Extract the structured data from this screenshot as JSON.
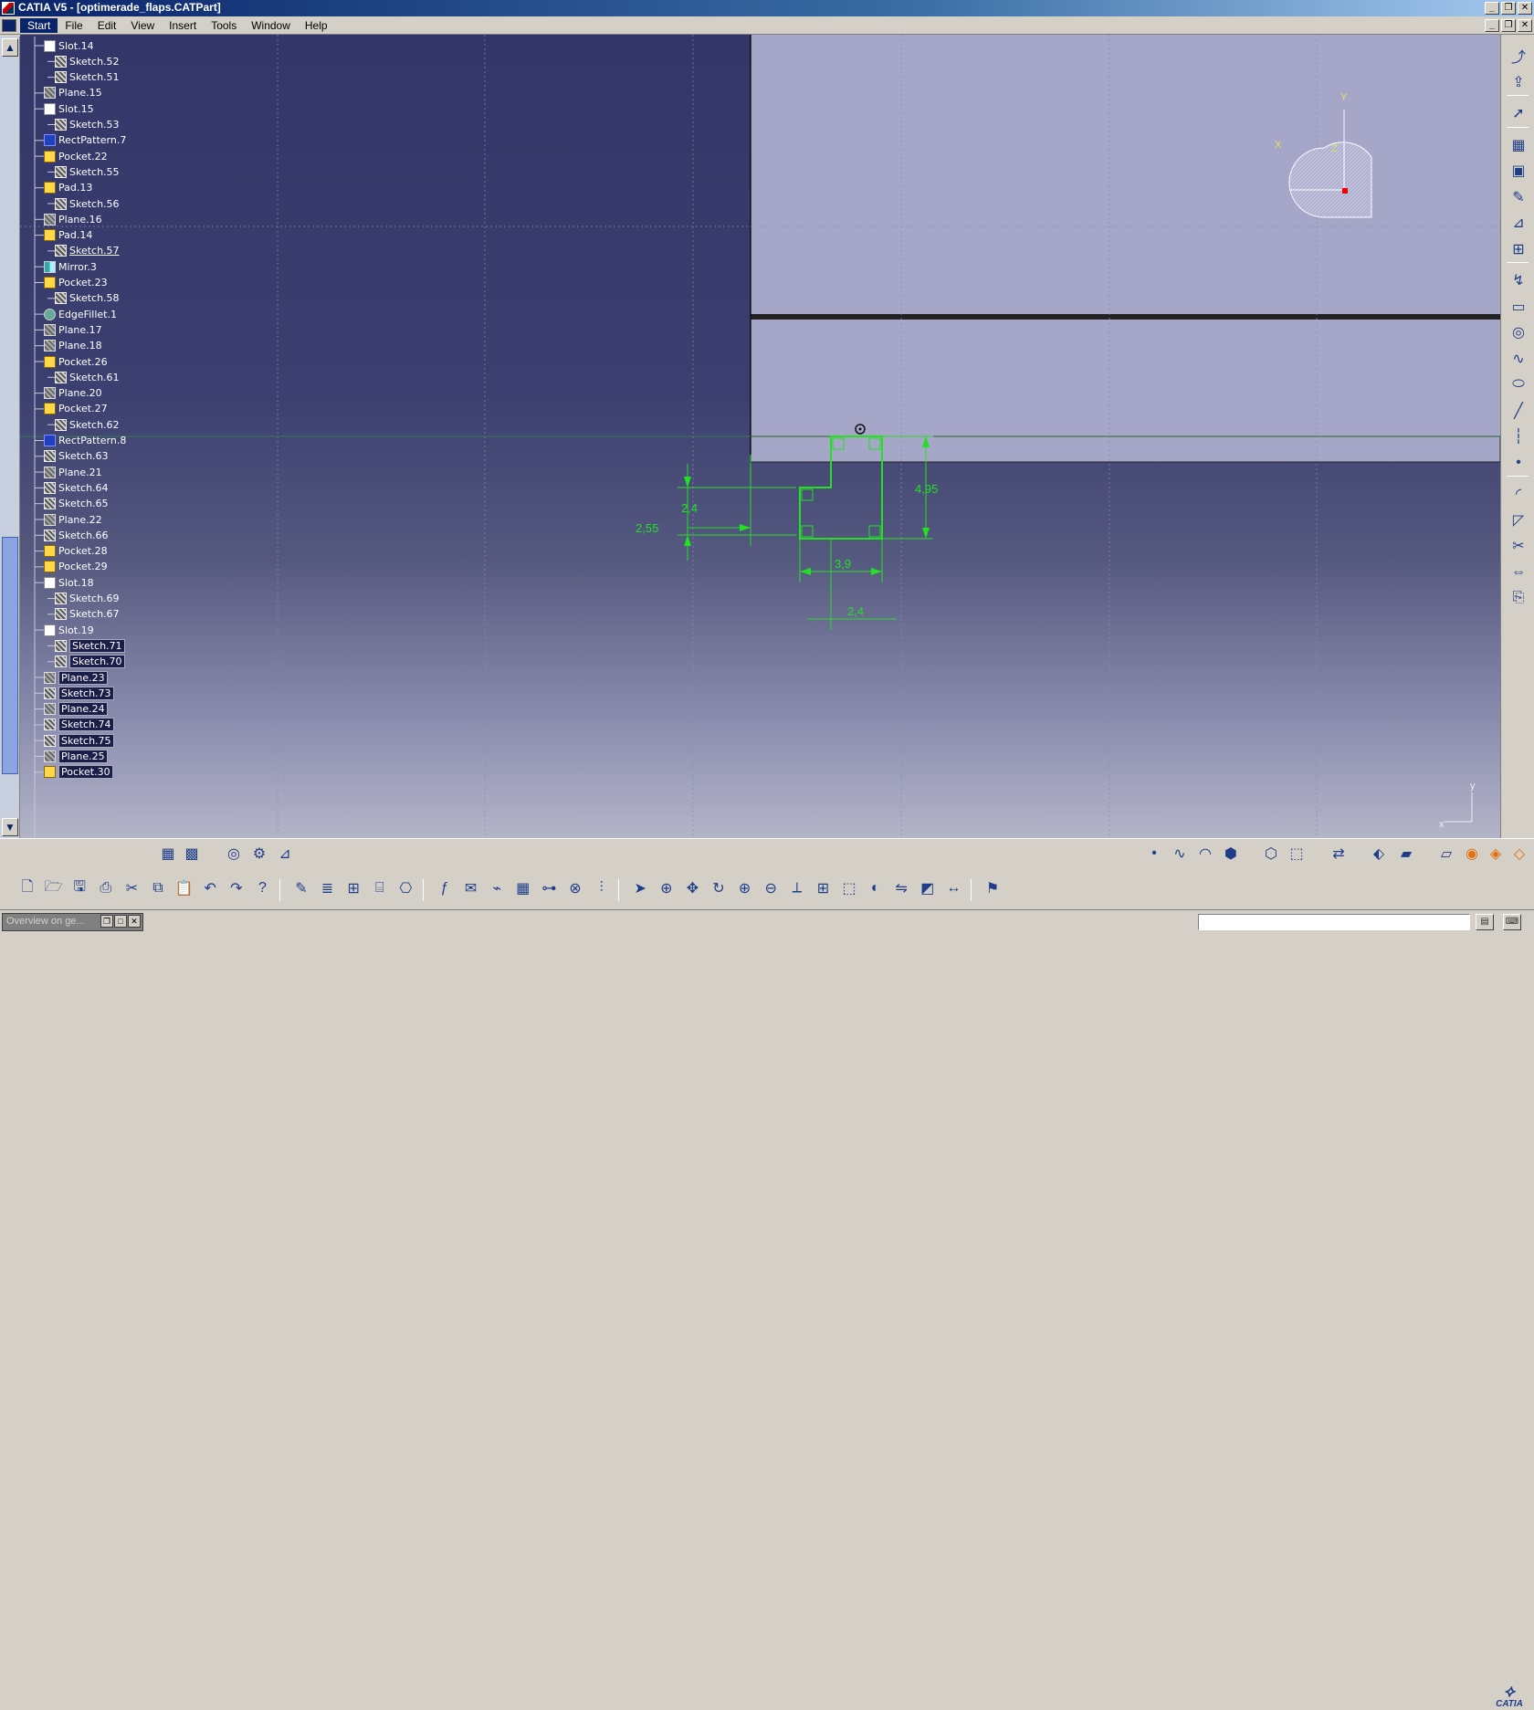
{
  "window": {
    "title": "CATIA V5 - [optimerade_flaps.CATPart]",
    "buttons": [
      "_",
      "❐",
      "✕"
    ]
  },
  "menu": {
    "items": [
      "Start",
      "File",
      "Edit",
      "View",
      "Insert",
      "Tools",
      "Window",
      "Help"
    ],
    "active": "Start",
    "doc_buttons": [
      "_",
      "❐",
      "✕"
    ]
  },
  "tree": {
    "nodes": [
      {
        "label": "Slot.14",
        "icon": "slot-icon",
        "level": 0
      },
      {
        "label": "Sketch.52",
        "icon": "sketch-icon",
        "level": 1
      },
      {
        "label": "Sketch.51",
        "icon": "sketch-icon",
        "level": 1
      },
      {
        "label": "Plane.15",
        "icon": "plane-icon",
        "level": 0
      },
      {
        "label": "Slot.15",
        "icon": "slot-icon",
        "level": 0
      },
      {
        "label": "Sketch.53",
        "icon": "sketch-icon",
        "level": 1
      },
      {
        "label": "RectPattern.7",
        "icon": "pattern-icon",
        "level": 0
      },
      {
        "label": "Pocket.22",
        "icon": "pocket-icon",
        "level": 0
      },
      {
        "label": "Sketch.55",
        "icon": "sketch-icon",
        "level": 1
      },
      {
        "label": "Pad.13",
        "icon": "pad-icon",
        "level": 0
      },
      {
        "label": "Sketch.56",
        "icon": "sketch-icon",
        "level": 1
      },
      {
        "label": "Plane.16",
        "icon": "plane-icon",
        "level": 0
      },
      {
        "label": "Pad.14",
        "icon": "pad-icon",
        "level": 0
      },
      {
        "label": "Sketch.57",
        "icon": "sketch-icon",
        "level": 1,
        "underline": true
      },
      {
        "label": "Mirror.3",
        "icon": "mirror-icon",
        "level": 0
      },
      {
        "label": "Pocket.23",
        "icon": "pocket-icon",
        "level": 0
      },
      {
        "label": "Sketch.58",
        "icon": "sketch-icon",
        "level": 1
      },
      {
        "label": "EdgeFillet.1",
        "icon": "fillet-icon",
        "level": 0
      },
      {
        "label": "Plane.17",
        "icon": "plane-icon",
        "level": 0
      },
      {
        "label": "Plane.18",
        "icon": "plane-icon",
        "level": 0
      },
      {
        "label": "Pocket.26",
        "icon": "pocket-icon",
        "level": 0
      },
      {
        "label": "Sketch.61",
        "icon": "sketch-icon",
        "level": 1
      },
      {
        "label": "Plane.20",
        "icon": "plane-icon",
        "level": 0
      },
      {
        "label": "Pocket.27",
        "icon": "pocket-icon",
        "level": 0
      },
      {
        "label": "Sketch.62",
        "icon": "sketch-icon",
        "level": 1
      },
      {
        "label": "RectPattern.8",
        "icon": "pattern-icon",
        "level": 0
      },
      {
        "label": "Sketch.63",
        "icon": "sketch-icon",
        "level": 0
      },
      {
        "label": "Plane.21",
        "icon": "plane-icon",
        "level": 0
      },
      {
        "label": "Sketch.64",
        "icon": "sketch-icon",
        "level": 0
      },
      {
        "label": "Sketch.65",
        "icon": "sketch-icon",
        "level": 0
      },
      {
        "label": "Plane.22",
        "icon": "plane-icon",
        "level": 0
      },
      {
        "label": "Sketch.66",
        "icon": "sketch-icon",
        "level": 0
      },
      {
        "label": "Pocket.28",
        "icon": "pocket-icon",
        "level": 0
      },
      {
        "label": "Pocket.29",
        "icon": "pocket-icon",
        "level": 0
      },
      {
        "label": "Slot.18",
        "icon": "slot-icon",
        "level": 0
      },
      {
        "label": "Sketch.69",
        "icon": "sketch-icon",
        "level": 1
      },
      {
        "label": "Sketch.67",
        "icon": "sketch-icon",
        "level": 1
      },
      {
        "label": "Slot.19",
        "icon": "slot-icon",
        "level": 0
      },
      {
        "label": "Sketch.71",
        "icon": "sketch-icon",
        "level": 1,
        "selected": true
      },
      {
        "label": "Sketch.70",
        "icon": "sketch-icon",
        "level": 1,
        "selected": true
      },
      {
        "label": "Plane.23",
        "icon": "plane-icon",
        "level": 0,
        "selected": true
      },
      {
        "label": "Sketch.73",
        "icon": "sketch-icon",
        "level": 0,
        "selected": true
      },
      {
        "label": "Plane.24",
        "icon": "plane-icon",
        "level": 0,
        "selected": true
      },
      {
        "label": "Sketch.74",
        "icon": "sketch-icon",
        "level": 0,
        "selected": true
      },
      {
        "label": "Sketch.75",
        "icon": "sketch-icon",
        "level": 0,
        "selected": true
      },
      {
        "label": "Plane.25",
        "icon": "plane-icon",
        "level": 0,
        "selected": true
      },
      {
        "label": "Pocket.30",
        "icon": "pocket-icon",
        "level": 0,
        "selected": true
      }
    ]
  },
  "sketch": {
    "dimensions": [
      "2,4",
      "2,55",
      "4,95",
      "3,9",
      "2,4"
    ],
    "compass_labels": {
      "y": "Y",
      "x": "X",
      "z": "Z"
    },
    "axis_labels": {
      "y": "y",
      "x": "x"
    },
    "colors": {
      "sketch": "#22e022",
      "part": "#a6a6c8",
      "grid": "#aab"
    }
  },
  "right_toolbar": {
    "icons": [
      "exit-workbench-icon",
      "export-icon",
      "select-icon",
      "grid-snap-icon",
      "construction-icon",
      "pencil-icon",
      "constraint-icon",
      "auto-constraint-icon",
      "profile-icon",
      "rectangle-icon",
      "circle-icon",
      "spline-icon",
      "ellipse-icon",
      "line-icon",
      "axis-icon",
      "point-icon",
      "corner-icon",
      "chamfer-icon",
      "trim-icon",
      "mirror-icon",
      "project-icon"
    ]
  },
  "bottom_toolbar": {
    "row1_icons": [
      "grid-icon",
      "snap-to-point-icon",
      "construction-elements-icon",
      "geometric-constraints-icon",
      "dimensional-constraints-icon",
      "point-icon",
      "spline-icon",
      "arc-icon",
      "sketch-analysis-icon",
      "normal-view-icon",
      "sketch-plane-icon",
      "swap-icon",
      "isometric-icon",
      "pad-icon",
      "pocket-icon",
      "shaft-icon",
      "hole-icon",
      "rib-icon"
    ],
    "row2_icons": [
      "new-icon",
      "open-icon",
      "save-icon",
      "print-icon",
      "cut-icon",
      "copy-icon",
      "paste-icon",
      "undo-icon",
      "redo-icon",
      "whats-this-icon",
      "sketch-icon",
      "list-icon",
      "tree-icon",
      "catalog-icon",
      "measure-icon",
      "formula-icon",
      "comment-icon",
      "knowledge-icon",
      "table-icon",
      "parameter-icon",
      "lock-icon",
      "publish-icon",
      "fly-icon",
      "fit-all-icon",
      "pan-icon",
      "rotate-icon",
      "zoom-in-icon",
      "zoom-out-icon",
      "normal-icon",
      "multiview-icon",
      "views-icon",
      "hide-show-icon",
      "swap-visible-icon",
      "render-style-icon",
      "measure-between-icon",
      "apply-material-icon"
    ]
  },
  "status": {
    "overview_label": "Overview on ge...",
    "command_placeholder": ""
  },
  "logo": "CATIA"
}
